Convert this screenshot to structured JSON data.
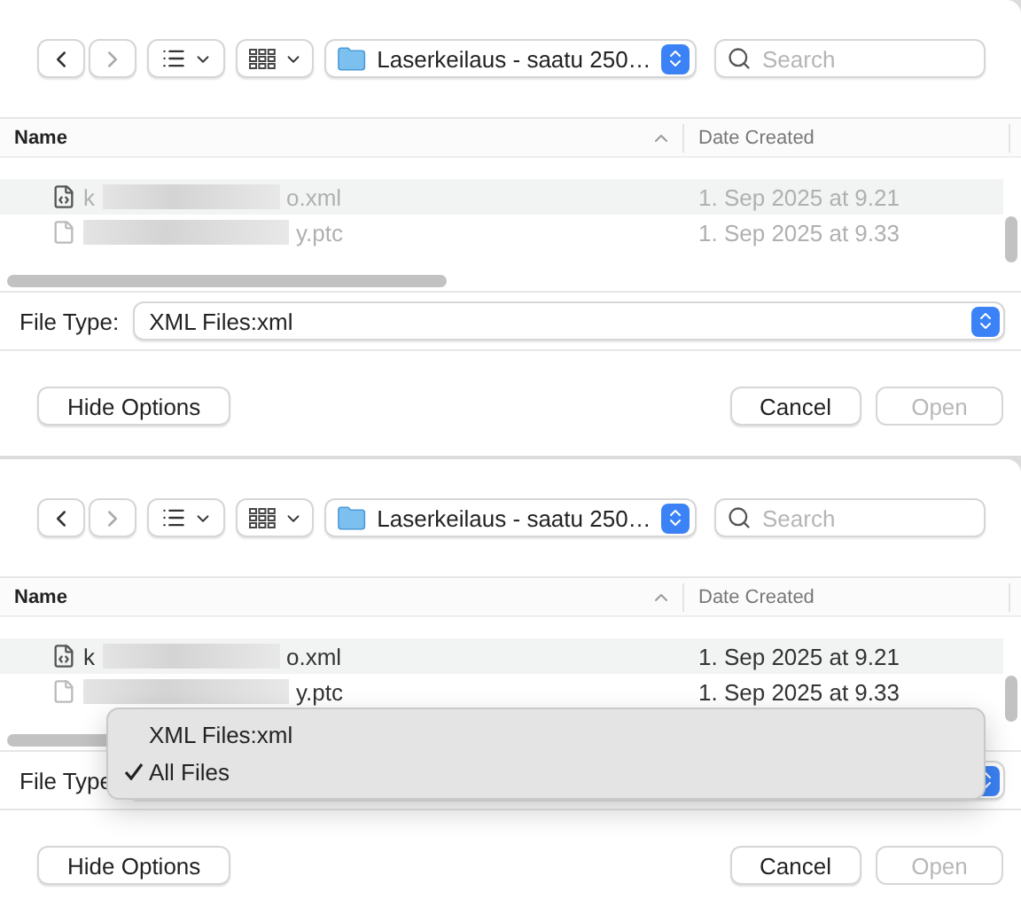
{
  "panels": [
    {
      "location": "Laserkeilaus - saatu 250…",
      "search": {
        "placeholder": "Search"
      },
      "columns": [
        {
          "label": "Name",
          "sorted": true
        },
        {
          "label": "Date Created",
          "sorted": false
        }
      ],
      "files": [
        {
          "kind": "xml",
          "name_start": "k",
          "name_end": "o.xml",
          "date": "1. Sep 2025 at 9.21",
          "selected": true,
          "disabled": true
        },
        {
          "kind": "doc",
          "name_end": "y.ptc",
          "date": "1. Sep 2025 at 9.33",
          "selected": false,
          "disabled": true
        }
      ],
      "file_type": {
        "label": "File Type:",
        "value": "XML Files:xml"
      },
      "buttons": [
        {
          "kind": "left",
          "label": "Hide Options",
          "disabled": false
        },
        {
          "kind": "right",
          "label": "Cancel",
          "disabled": false
        },
        {
          "kind": "right",
          "label": "Open",
          "disabled": true
        }
      ]
    },
    {
      "location": "Laserkeilaus - saatu 250…",
      "search": {
        "placeholder": "Search"
      },
      "columns": [
        {
          "label": "Name",
          "sorted": true
        },
        {
          "label": "Date Created",
          "sorted": false
        }
      ],
      "files": [
        {
          "kind": "xml",
          "name_start": "k",
          "name_end": "o.xml",
          "date": "1. Sep 2025 at 9.21",
          "selected": true,
          "disabled": false
        },
        {
          "kind": "doc",
          "name_end": "y.ptc",
          "date": "1. Sep 2025 at 9.33",
          "selected": false,
          "disabled": false
        }
      ],
      "file_type": {
        "label": "File Type"
      },
      "menu": [
        {
          "label": "XML Files:xml",
          "checked": false
        },
        {
          "label": "All Files",
          "checked": true
        }
      ],
      "buttons": [
        {
          "kind": "left",
          "label": "Hide Options",
          "disabled": false
        },
        {
          "kind": "right",
          "label": "Cancel",
          "disabled": false
        },
        {
          "kind": "right",
          "label": "Open",
          "disabled": true
        }
      ]
    }
  ]
}
